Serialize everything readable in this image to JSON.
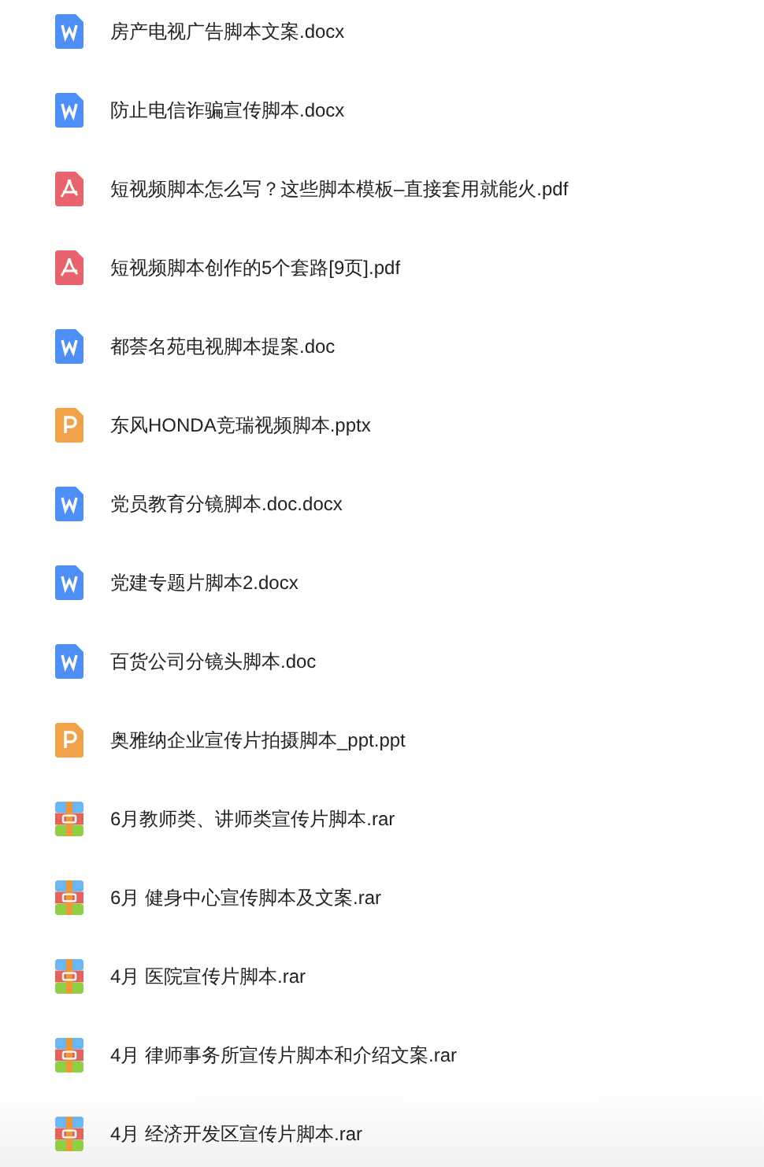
{
  "files": [
    {
      "name": "房产电视广告脚本文案.docx",
      "kind": "word"
    },
    {
      "name": "防止电信诈骗宣传脚本.docx",
      "kind": "word"
    },
    {
      "name": "短视频脚本怎么写？这些脚本模板–直接套用就能火.pdf",
      "kind": "pdf"
    },
    {
      "name": "短视频脚本创作的5个套路[9页].pdf",
      "kind": "pdf"
    },
    {
      "name": "都荟名苑电视脚本提案.doc",
      "kind": "word"
    },
    {
      "name": "东风HONDA竞瑞视频脚本.pptx",
      "kind": "ppt"
    },
    {
      "name": "党员教育分镜脚本.doc.docx",
      "kind": "word"
    },
    {
      "name": "党建专题片脚本2.docx",
      "kind": "word"
    },
    {
      "name": "百货公司分镜头脚本.doc",
      "kind": "word"
    },
    {
      "name": "奥雅纳企业宣传片拍摄脚本_ppt.ppt",
      "kind": "ppt"
    },
    {
      "name": "6月教师类、讲师类宣传片脚本.rar",
      "kind": "rar"
    },
    {
      "name": "6月 健身中心宣传脚本及文案.rar",
      "kind": "rar"
    },
    {
      "name": "4月 医院宣传片脚本.rar",
      "kind": "rar"
    },
    {
      "name": "4月 律师事务所宣传片脚本和介绍文案.rar",
      "kind": "rar"
    },
    {
      "name": "4月 经济开发区宣传片脚本.rar",
      "kind": "rar"
    }
  ]
}
